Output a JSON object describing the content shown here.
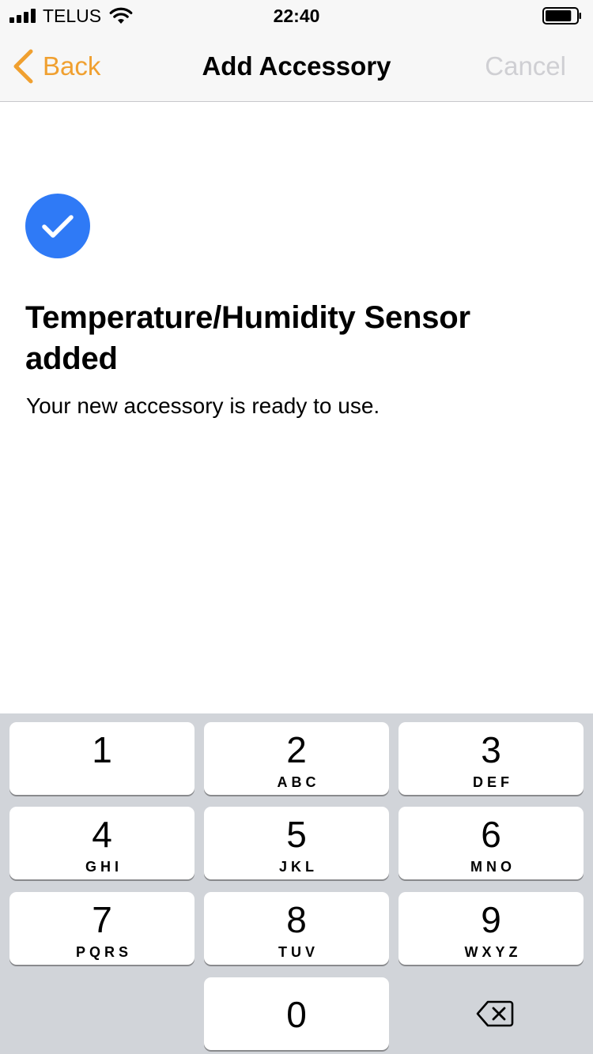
{
  "status_bar": {
    "carrier": "TELUS",
    "time": "22:40",
    "signal_bars": 4,
    "battery_level": 0.85
  },
  "nav": {
    "back_label": "Back",
    "title": "Add Accessory",
    "cancel_label": "Cancel"
  },
  "content": {
    "title": "Temperature/Humidity Sensor added",
    "subtitle": "Your new accessory is ready to use."
  },
  "keypad": {
    "keys": [
      {
        "digit": "1",
        "letters": ""
      },
      {
        "digit": "2",
        "letters": "ABC"
      },
      {
        "digit": "3",
        "letters": "DEF"
      },
      {
        "digit": "4",
        "letters": "GHI"
      },
      {
        "digit": "5",
        "letters": "JKL"
      },
      {
        "digit": "6",
        "letters": "MNO"
      },
      {
        "digit": "7",
        "letters": "PQRS"
      },
      {
        "digit": "8",
        "letters": "TUV"
      },
      {
        "digit": "9",
        "letters": "WXYZ"
      },
      {
        "digit": "0",
        "letters": ""
      }
    ]
  },
  "colors": {
    "accent": "#f0a030",
    "check_badge": "#2f7af6",
    "cancel_disabled": "#cfcfd3",
    "keypad_background": "#d1d4d9"
  },
  "icons": {
    "signal": "cellular-signal-icon",
    "wifi": "wifi-icon",
    "battery": "battery-icon",
    "back": "chevron-left-icon",
    "success": "checkmark-icon",
    "delete": "backspace-icon"
  }
}
